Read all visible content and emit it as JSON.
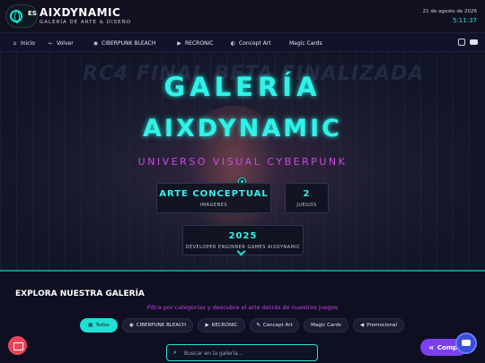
{
  "header": {
    "lang_code": "ES",
    "brand": "AIXDYNAMIC",
    "tagline": "GALERÍA DE ARTE & DISEÑO",
    "date": "21 de agosto de 2026",
    "time": "5:11:37"
  },
  "nav": {
    "items": [
      {
        "icon": "home-icon",
        "glyph": "⌂",
        "label": "Inicio"
      },
      {
        "icon": "arrow-left-icon",
        "glyph": "←",
        "label": "Volver"
      },
      {
        "icon": "eye-icon",
        "glyph": "◉",
        "label": "CIBERPUNK BLEACH"
      },
      {
        "icon": "film-icon",
        "glyph": "▶",
        "label": "RECRONIC"
      },
      {
        "icon": "palette-icon",
        "glyph": "◐",
        "label": "Concept Art"
      },
      {
        "icon": "",
        "glyph": "",
        "label": "Magic Cards"
      }
    ],
    "social": [
      "instagram-icon",
      "youtube-icon"
    ]
  },
  "hero": {
    "background_text": "RC4 FINAL BETA FINALIZADA",
    "title_line1": "GALERÍA",
    "title_line2": "AIXDYNAMIC",
    "subtitle": "UNIVERSO VISUAL CYBERPUNK",
    "stats": [
      {
        "value": "ARTE CONCEPTUAL",
        "label": "IMÁGENES"
      },
      {
        "value": "2",
        "label": "JUEGOS"
      },
      {
        "value": "2025",
        "label": "DEVELOPER ENGINNER GAMES AIXDYNAMIC"
      }
    ]
  },
  "explore": {
    "title": "EXPLORA NUESTRA GALERÍA",
    "subtitle": "Filtra por categorías y descubre el arte detrás de nuestros juegos",
    "filters": [
      {
        "label": "Todos",
        "icon": "grid-icon",
        "glyph": "▦",
        "active": true
      },
      {
        "label": "CIBERPUNK BLEACH",
        "icon": "eye-icon",
        "glyph": "◉",
        "active": false
      },
      {
        "label": "RECRONIC",
        "icon": "film-icon",
        "glyph": "▶",
        "active": false
      },
      {
        "label": "Concept Art",
        "icon": "brush-icon",
        "glyph": "✎",
        "active": false
      },
      {
        "label": "Magic Cards",
        "icon": "",
        "glyph": "",
        "active": false
      },
      {
        "label": "Promocional",
        "icon": "megaphone-icon",
        "glyph": "◀",
        "active": false
      }
    ],
    "search_placeholder": "Buscar en la galería..."
  },
  "floating": {
    "share_label": "Compartir"
  },
  "colors": {
    "accent": "#21e0d6",
    "magenta": "#d046e8",
    "share": "#7b3ff0"
  }
}
